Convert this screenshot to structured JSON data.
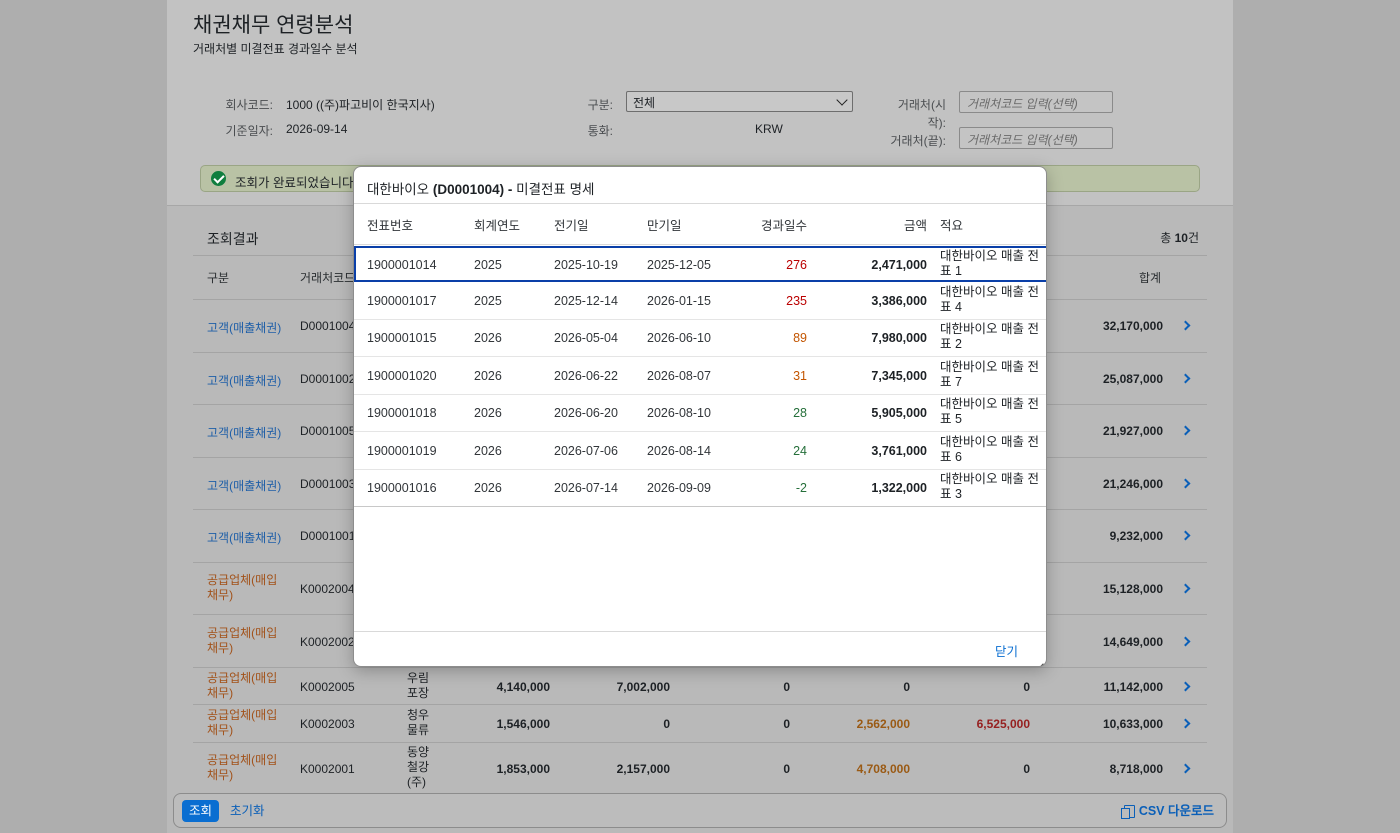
{
  "page": {
    "title": "채권채무 연령분석",
    "subtitle": "거래처별 미결전표 경과일수 분석"
  },
  "filters": {
    "company_label": "회사코드:",
    "company_value": "1000 ((주)파고비이 한국지사)",
    "keydate_label": "기준일자:",
    "keydate_value": "2026-09-14",
    "type_label": "구분:",
    "type_value": "전체",
    "currency_label": "통화:",
    "currency_value": "KRW",
    "partner_from_label_1": "거래처(시",
    "partner_from_label_2": "작):",
    "partner_from_placeholder": "거래처코드 입력(선택)",
    "partner_to_label": "거래처(끝):",
    "partner_to_placeholder": "거래처코드 입력(선택)"
  },
  "message": {
    "text": "조회가 완료되었습니다"
  },
  "results": {
    "title": "조회결과",
    "count_prefix": "총 ",
    "count": "10",
    "count_suffix": "건",
    "headers": {
      "category": "구분",
      "partner_code": "거래처코드",
      "total": "합계"
    },
    "rows": [
      {
        "category": "고객(매출채권)",
        "code": "D0001004",
        "total": "32,170,000"
      },
      {
        "category": "고객(매출채권)",
        "code": "D0001002",
        "total": "25,087,000"
      },
      {
        "category": "고객(매출채권)",
        "code": "D0001005",
        "total": "21,927,000"
      },
      {
        "category": "고객(매출채권)",
        "code": "D0001003",
        "total": "21,246,000"
      },
      {
        "category": "고객(매출채권)",
        "code": "D0001001",
        "total": "9,232,000"
      },
      {
        "category_1": "공급업체(매입",
        "category_2": "채무)",
        "code": "K0002004",
        "total": "15,128,000"
      },
      {
        "category_1": "공급업체(매입",
        "category_2": "채무)",
        "code": "K0002002",
        "total": "14,649,000"
      },
      {
        "category_1": "공급업체(매입",
        "category_2": "채무)",
        "code": "K0002005",
        "name_1": "우림",
        "name_2": "포장",
        "b1": "4,140,000",
        "b2": "7,002,000",
        "b3": "0",
        "b4": "0",
        "b5": "0",
        "total": "11,142,000"
      },
      {
        "category_1": "공급업체(매입",
        "category_2": "채무)",
        "code": "K0002003",
        "name_1": "청우",
        "name_2": "물류",
        "b1": "1,546,000",
        "b2": "0",
        "b3": "0",
        "b4": "2,562,000",
        "b5": "6,525,000",
        "total": "10,633,000"
      },
      {
        "category_1": "공급업체(매입",
        "category_2": "채무)",
        "code": "K0002001",
        "name_1": "동양",
        "name_2": "철강",
        "name_3": "(주)",
        "b1": "1,853,000",
        "b2": "2,157,000",
        "b3": "0",
        "b4": "4,708,000",
        "b5": "0",
        "total": "8,718,000"
      }
    ]
  },
  "footer": {
    "query": "조회",
    "reset": "초기화",
    "csv": "CSV 다운로드"
  },
  "dialog": {
    "title_name": "대한바이오 ",
    "title_code": "(D0001004) - ",
    "title_suffix": "미결전표 명세",
    "headers": {
      "doc_no": "전표번호",
      "fiscal_year": "회계연도",
      "posting_date": "전기일",
      "due_date": "만기일",
      "days_overdue": "경과일수",
      "amount": "금액",
      "memo": "적요"
    },
    "rows": [
      {
        "doc_no": "1900001014",
        "year": "2025",
        "posting": "2025-10-19",
        "due": "2025-12-05",
        "days": "276",
        "amount": "2,471,000",
        "memo": "대한바이오 매출 전표 1"
      },
      {
        "doc_no": "1900001017",
        "year": "2025",
        "posting": "2025-12-14",
        "due": "2026-01-15",
        "days": "235",
        "amount": "3,386,000",
        "memo": "대한바이오 매출 전표 4"
      },
      {
        "doc_no": "1900001015",
        "year": "2026",
        "posting": "2026-05-04",
        "due": "2026-06-10",
        "days": "89",
        "amount": "7,980,000",
        "memo": "대한바이오 매출 전표 2"
      },
      {
        "doc_no": "1900001020",
        "year": "2026",
        "posting": "2026-06-22",
        "due": "2026-08-07",
        "days": "31",
        "amount": "7,345,000",
        "memo": "대한바이오 매출 전표 7"
      },
      {
        "doc_no": "1900001018",
        "year": "2026",
        "posting": "2026-06-20",
        "due": "2026-08-10",
        "days": "28",
        "amount": "5,905,000",
        "memo": "대한바이오 매출 전표 5"
      },
      {
        "doc_no": "1900001019",
        "year": "2026",
        "posting": "2026-07-06",
        "due": "2026-08-14",
        "days": "24",
        "amount": "3,761,000",
        "memo": "대한바이오 매출 전표 6"
      },
      {
        "doc_no": "1900001016",
        "year": "2026",
        "posting": "2026-07-14",
        "due": "2026-09-09",
        "days": "-2",
        "amount": "1,322,000",
        "memo": "대한바이오 매출 전표 3"
      }
    ],
    "close": "닫기"
  },
  "colors": {
    "accent": "#0a6ed1",
    "overdue_high": "#bb0000",
    "overdue_mid": "#c35500",
    "overdue_low": "#256f3a"
  }
}
